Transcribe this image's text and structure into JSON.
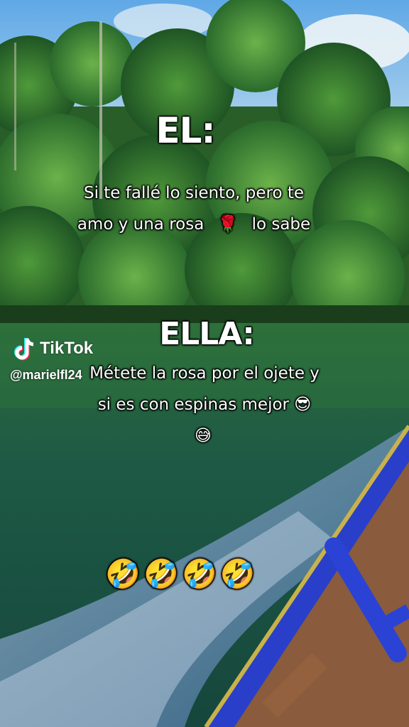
{
  "watermark": {
    "brand": "TikTok",
    "handle": "@marielfl24"
  },
  "caption": {
    "heading_him": "EL:",
    "him_line1": "Si te fallé lo siento, pero te",
    "him_line2_a": "amo y una rosa",
    "him_line2_emoji": "🌹",
    "him_line2_b": "lo sabe",
    "heading_her": "ELLA:",
    "her_line1": "Métete la rosa por el ojete y",
    "her_line2": "si es con espinas mejor 😎",
    "her_line3": "😅",
    "laughing_row": "🤣🤣🤣🤣"
  },
  "colors": {
    "sky": "#5aa6e0",
    "forest": "#2f6e2e",
    "river": "#1f5a48",
    "boat_rim": "#2438c8",
    "boat_wood": "#8a5a3a"
  }
}
